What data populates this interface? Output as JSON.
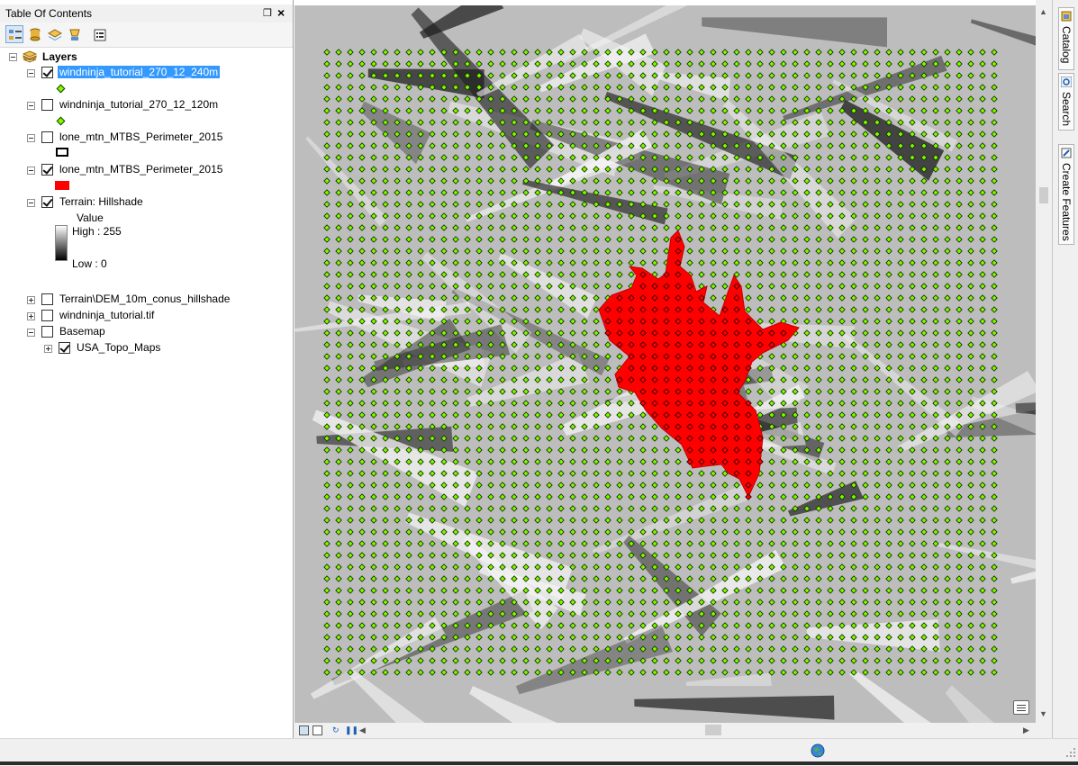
{
  "toc": {
    "title": "Table Of Contents",
    "pin_glyph": "❒",
    "close_glyph": "×",
    "toolbar": [
      {
        "name": "list-by-drawing-order-button",
        "icon": "layers-list-icon"
      },
      {
        "name": "list-by-source-button",
        "icon": "database-icon"
      },
      {
        "name": "list-by-visibility-button",
        "icon": "layers-stack-icon"
      },
      {
        "name": "list-by-selection-button",
        "icon": "selection-icon"
      },
      {
        "name": "options-button",
        "icon": "options-icon"
      }
    ],
    "root_label": "Layers",
    "layers": [
      {
        "label": "windninja_tutorial_270_12_240m",
        "checked": true,
        "selected": true,
        "symbol": "point"
      },
      {
        "label": "windninja_tutorial_270_12_120m",
        "checked": false,
        "selected": false,
        "symbol": "point"
      },
      {
        "label": "lone_mtn_MTBS_Perimeter_2015",
        "checked": false,
        "selected": false,
        "symbol": "outline-polygon"
      },
      {
        "label": "lone_mtn_MTBS_Perimeter_2015",
        "checked": true,
        "selected": false,
        "symbol": "red-polygon"
      },
      {
        "label": "Terrain: Hillshade",
        "checked": true,
        "selected": false,
        "symbol": "ramp"
      }
    ],
    "hillshade_legend": {
      "title": "Value",
      "high": "High : 255",
      "low": "Low : 0"
    },
    "collapsed_layers": [
      {
        "label": "Terrain\\DEM_10m_conus_hillshade",
        "checked": false
      },
      {
        "label": "windninja_tutorial.tif",
        "checked": false
      },
      {
        "label": "Basemap",
        "checked": false
      }
    ],
    "sublayer": {
      "label": "USA_Topo_Maps",
      "checked": true
    }
  },
  "dock": {
    "tabs": [
      {
        "label": "Catalog",
        "icon": "catalog-icon"
      },
      {
        "label": "Search",
        "icon": "search-icon"
      },
      {
        "label": "Create Features",
        "icon": "create-features-icon"
      }
    ]
  },
  "map": {
    "colors": {
      "point_fill": "#7cfc00",
      "point_outline": "#1a3300",
      "fire_perimeter": "#ff0000",
      "hillshade_dark": "#1e1e1e",
      "hillshade_light": "#f4f4f4"
    }
  },
  "status": {
    "icon": "globe-icon"
  }
}
